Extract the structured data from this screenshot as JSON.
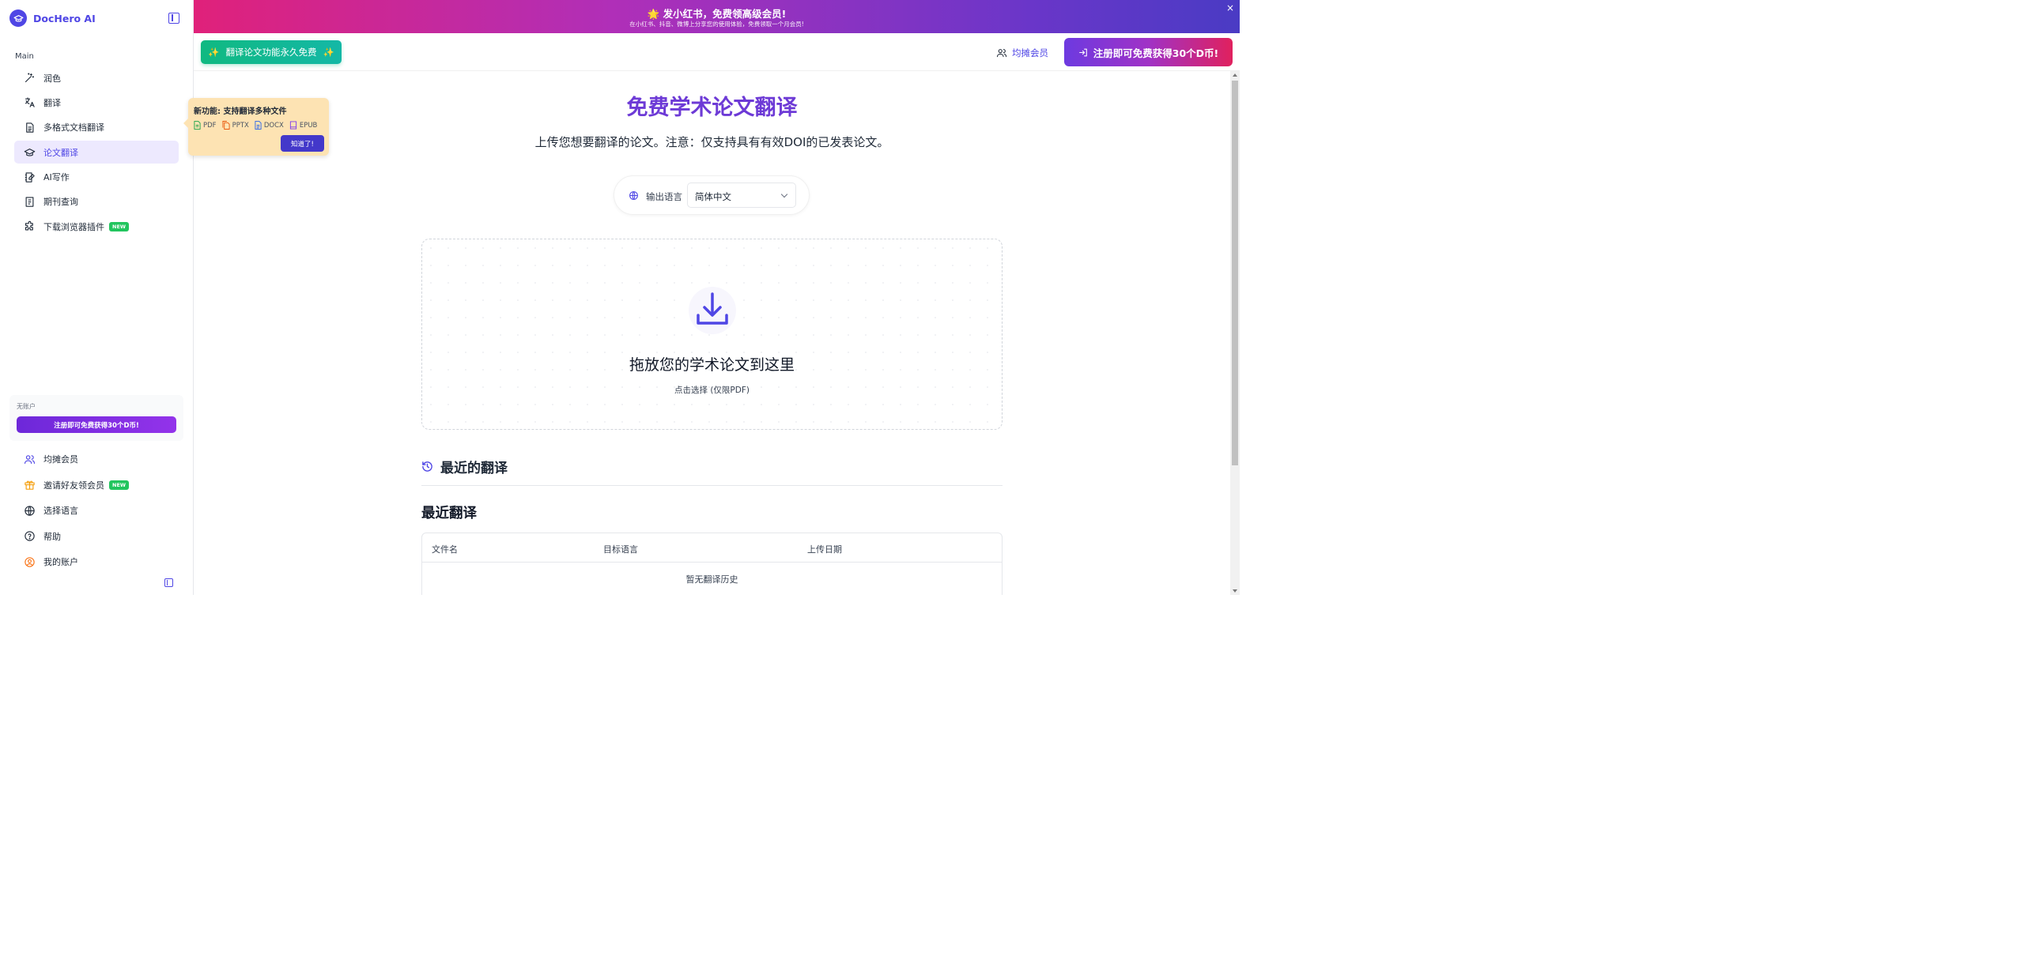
{
  "app": {
    "brand_name": "DocHero AI",
    "accent": "#4f46e5"
  },
  "sidebar": {
    "section_label": "Main",
    "items": [
      {
        "label": "润色",
        "icon": "magic-wand-icon"
      },
      {
        "label": "翻译",
        "icon": "translate-icon"
      },
      {
        "label": "多格式文档翻译",
        "icon": "document-icon"
      },
      {
        "label": "论文翻译",
        "icon": "graduation-cap-icon",
        "active": true
      },
      {
        "label": "AI写作",
        "icon": "notebook-pen-icon"
      },
      {
        "label": "期刊查询",
        "icon": "journal-icon"
      },
      {
        "label": "下载浏览器插件",
        "icon": "puzzle-icon",
        "badge": "NEW"
      }
    ],
    "account": {
      "status": "无账户",
      "register_label": "注册即可免费获得30个D币!"
    },
    "bottom_items": [
      {
        "label": "均摊会员",
        "icon": "users-icon"
      },
      {
        "label": "邀请好友领会员",
        "icon": "gift-icon",
        "badge": "NEW"
      },
      {
        "label": "选择语言",
        "icon": "globe-icon"
      },
      {
        "label": "帮助",
        "icon": "help-circle-icon"
      },
      {
        "label": "我的账户",
        "icon": "user-circle-icon"
      }
    ]
  },
  "tooltip": {
    "title": "新功能: 支持翻译多种文件",
    "file_types": [
      "PDF",
      "PPTX",
      "DOCX",
      "EPUB"
    ],
    "button_label": "知道了!"
  },
  "banner": {
    "title": "🌟 发小红书，免费领高级会员!",
    "subtitle": "在小红书、抖音、微博上分享您的使用体验，免费领取一个月会员!",
    "close": "×"
  },
  "header": {
    "free_label": "翻译论文功能永久免费",
    "sparkle": "✨",
    "member_label": "均摊会员",
    "signup_label": "注册即可免费获得30个D币!"
  },
  "main": {
    "title": "免费学术论文翻译",
    "description": "上传您想要翻译的论文。注意：仅支持具有有效DOI的已发表论文。",
    "output_language_label": "输出语言",
    "output_language_value": "简体中文",
    "dropzone_title": "拖放您的学术论文到这里",
    "dropzone_subtitle": "点击选择 (仅限PDF)",
    "recent_heading": "最近的翻译",
    "recent_subheading": "最近翻译",
    "table_headers": [
      "文件名",
      "目标语言",
      "上传日期"
    ],
    "empty_text": "暂无翻译历史"
  }
}
